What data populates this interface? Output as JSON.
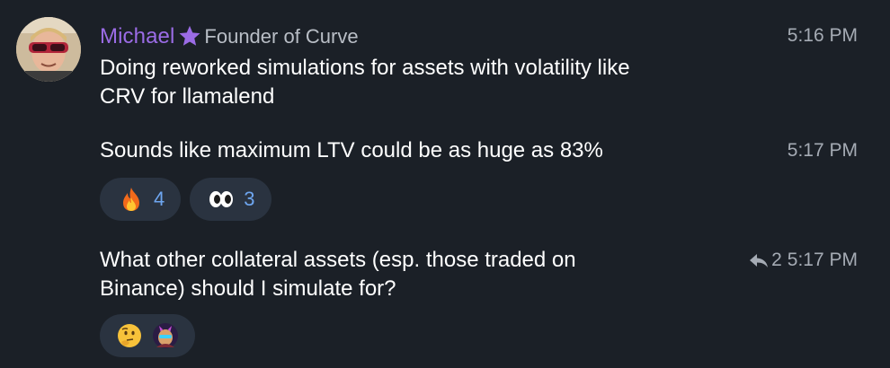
{
  "sender": {
    "name": "Michael",
    "title": "Founder of Curve",
    "name_color": "#9b6ce6",
    "badge_icon": "star-icon"
  },
  "messages": [
    {
      "text": "Doing reworked simulations for assets with volatility like\nCRV for llamalend",
      "time": "5:16 PM"
    },
    {
      "text": "Sounds like maximum LTV could be as huge as 83%",
      "time": "5:17 PM",
      "reactions": [
        {
          "emoji": "fire-emoji",
          "count": "4"
        },
        {
          "emoji": "eyes-emoji",
          "count": "3"
        }
      ]
    },
    {
      "text": "What other collateral assets (esp. those traded on\nBinance) should I simulate for?",
      "time": "5:17 PM",
      "reply_count": "2",
      "reactions": [
        {
          "emoji": "thinking-face-emoji"
        },
        {
          "emoji": "llama-avatar-emoji"
        }
      ]
    }
  ],
  "colors": {
    "background": "#1b2027",
    "reaction_bg": "#2a3340",
    "reaction_count": "#6ea6f0",
    "meta_text": "#a5abb4"
  }
}
